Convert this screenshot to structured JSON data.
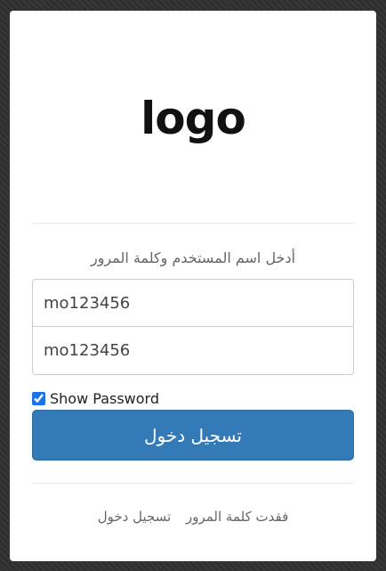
{
  "logo": {
    "text": "logo"
  },
  "login": {
    "prompt": "أدخل اسم المستخدم وكلمة المرور",
    "username_value": "mo123456",
    "password_value": "mo123456",
    "show_password_label": "Show Password",
    "show_password_checked": true,
    "submit_label": "تسجيل دخول"
  },
  "footer": {
    "forgot_password_label": "فقدت كلمة المرور",
    "login_link_label": "تسجيل دخول"
  },
  "colors": {
    "primary_button": "#337ab7",
    "background": "#2f2f2f"
  }
}
